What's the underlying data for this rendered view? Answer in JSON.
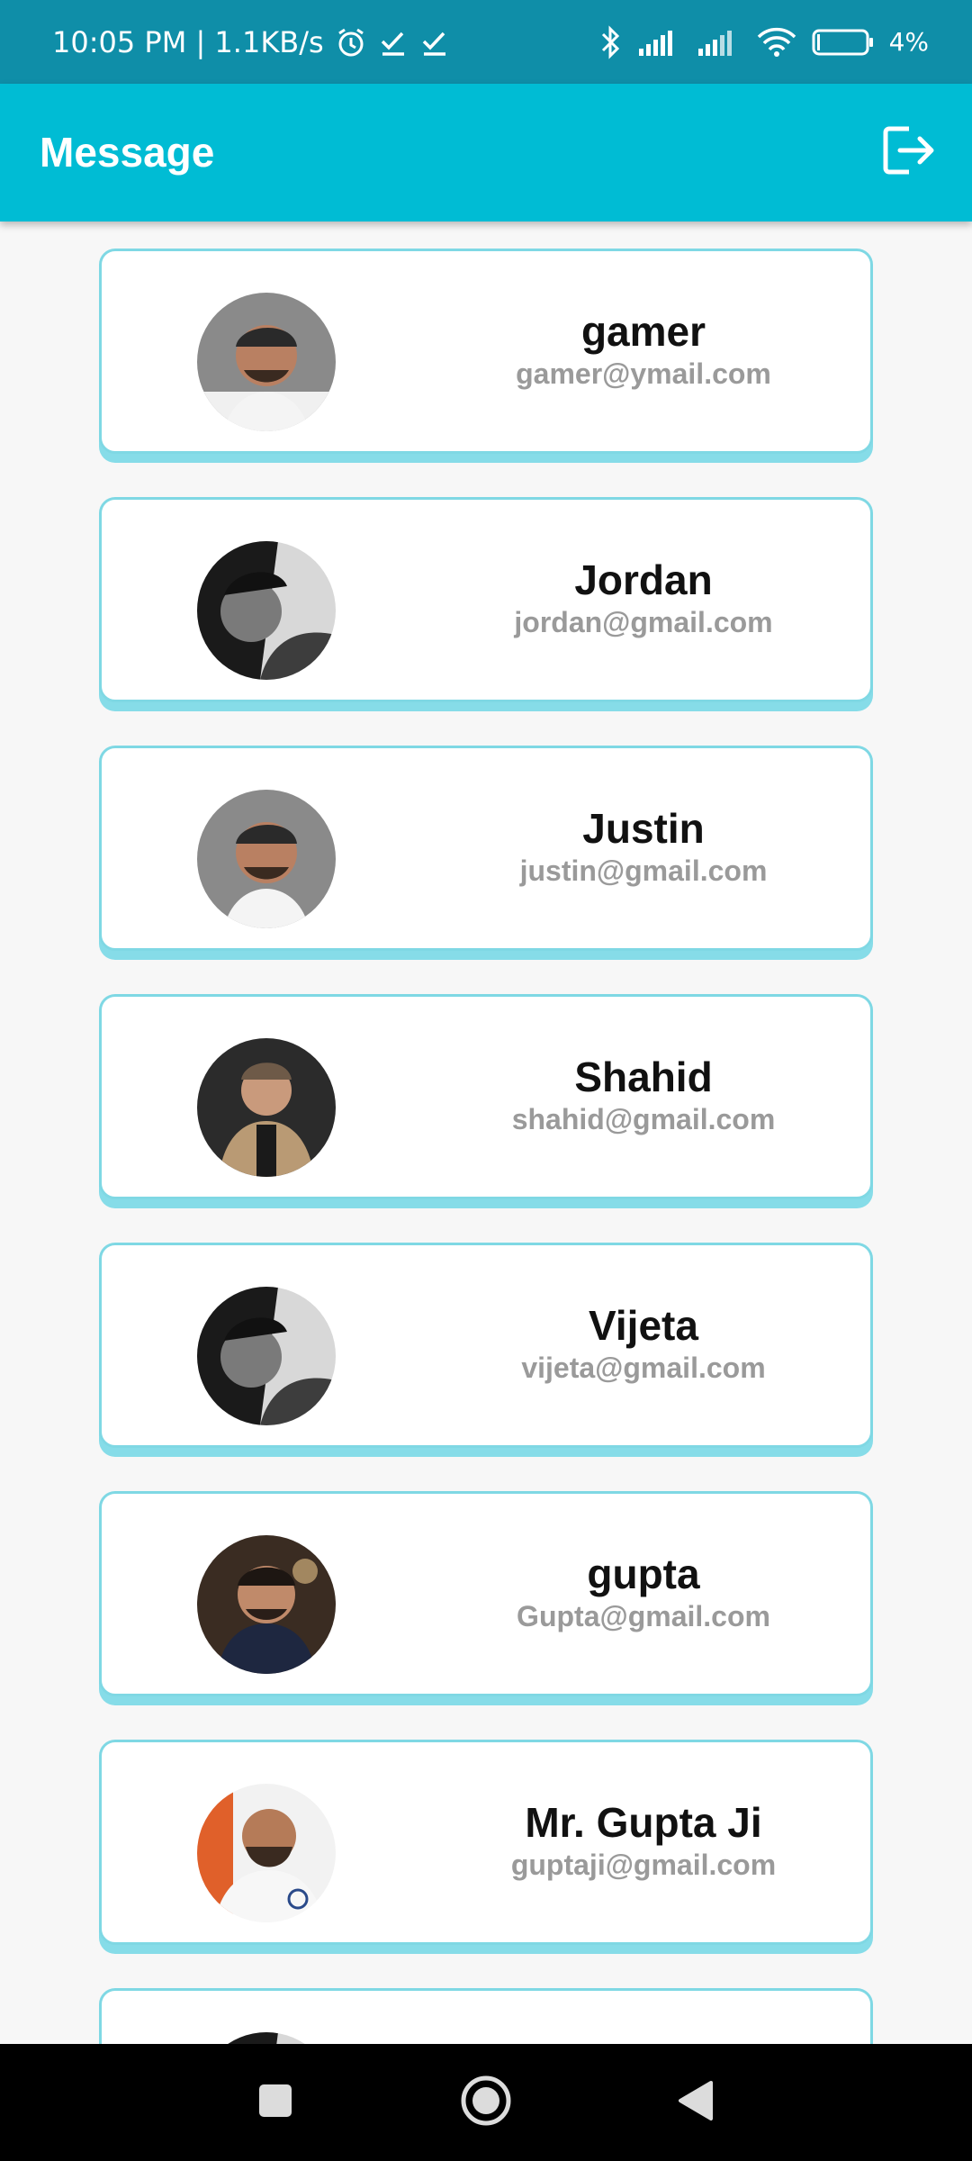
{
  "status_bar": {
    "time_speed": "10:05 PM | 1.1KB/s",
    "battery": "4%",
    "icons": [
      "alarm-icon",
      "check-icon",
      "check-icon",
      "bluetooth-icon",
      "signal-icon",
      "signal-icon",
      "wifi-icon",
      "battery-icon"
    ]
  },
  "app_bar": {
    "title": "Message",
    "logout_icon": "logout-icon",
    "background": "#00bcd4"
  },
  "contacts": [
    {
      "name": "gamer",
      "email": "gamer@ymail.com",
      "avatar": "avatar-photo"
    },
    {
      "name": "Jordan",
      "email": "jordan@gmail.com",
      "avatar": "avatar-photo"
    },
    {
      "name": "Justin",
      "email": "justin@gmail.com",
      "avatar": "avatar-photo"
    },
    {
      "name": "Shahid",
      "email": "shahid@gmail.com",
      "avatar": "avatar-photo"
    },
    {
      "name": "Vijeta",
      "email": "vijeta@gmail.com",
      "avatar": "avatar-photo"
    },
    {
      "name": "gupta",
      "email": "Gupta@gmail.com",
      "avatar": "avatar-photo"
    },
    {
      "name": "Mr. Gupta Ji",
      "email": "guptaji@gmail.com",
      "avatar": "avatar-photo"
    }
  ],
  "nav_bar": {
    "buttons": [
      "recents-square-icon",
      "home-circle-icon",
      "back-triangle-icon"
    ]
  },
  "colors": {
    "status_bar": "#0f8ea8",
    "accent": "#00bcd4",
    "card_border": "#7fd8e4",
    "email_text": "#9a9a9a"
  }
}
